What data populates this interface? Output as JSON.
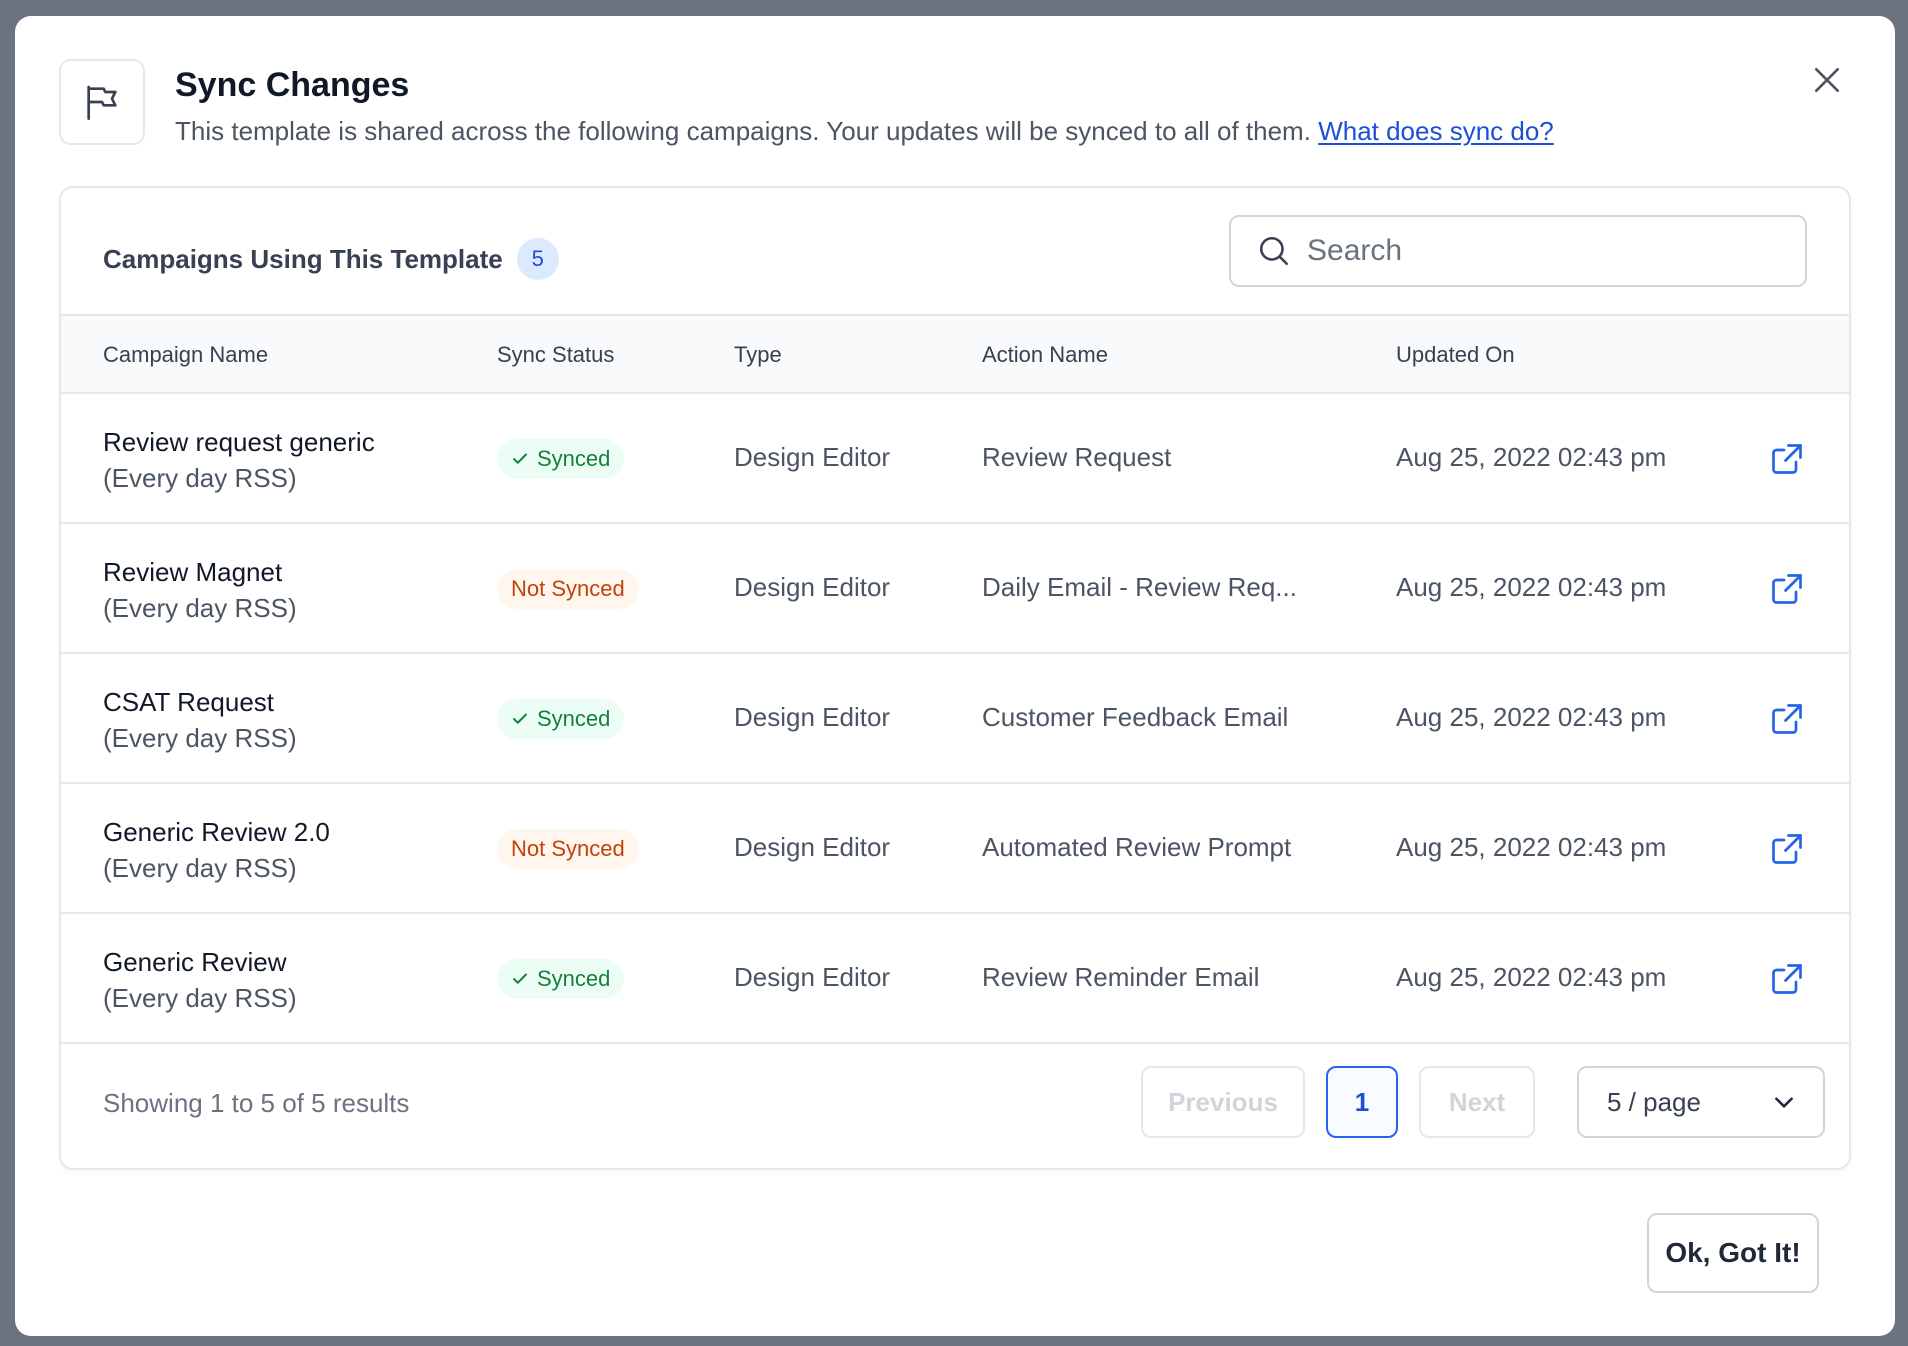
{
  "dialog": {
    "title": "Sync Changes",
    "subtitle": "This template is shared across the following campaigns. Your updates will be synced to all of them.",
    "help_link": "What does sync do?",
    "ok_label": "Ok, Got It!"
  },
  "card": {
    "title": "Campaigns Using This Template",
    "count": "5",
    "search_placeholder": "Search"
  },
  "table": {
    "columns": [
      "Campaign Name",
      "Sync Status",
      "Type",
      "Action Name",
      "Updated On"
    ],
    "rows": [
      {
        "name": "Review request generic",
        "sub": "(Every day RSS)",
        "status": "Synced",
        "type": "Design Editor",
        "action": "Review Request",
        "updated": "Aug 25, 2022 02:43 pm"
      },
      {
        "name": "Review Magnet",
        "sub": "(Every day RSS)",
        "status": "Not Synced",
        "type": "Design Editor",
        "action": "Daily Email - Review Req...",
        "updated": "Aug 25, 2022 02:43 pm"
      },
      {
        "name": "CSAT Request",
        "sub": "(Every day RSS)",
        "status": "Synced",
        "type": "Design Editor",
        "action": "Customer Feedback Email",
        "updated": "Aug 25, 2022 02:43 pm"
      },
      {
        "name": "Generic Review 2.0",
        "sub": "(Every day RSS)",
        "status": "Not Synced",
        "type": "Design Editor",
        "action": "Automated Review Prompt",
        "updated": "Aug 25, 2022 02:43 pm"
      },
      {
        "name": "Generic Review",
        "sub": "(Every day RSS)",
        "status": "Synced",
        "type": "Design Editor",
        "action": "Review Reminder Email",
        "updated": "Aug 25, 2022 02:43 pm"
      }
    ]
  },
  "pagination": {
    "summary": "Showing 1 to 5 of 5 results",
    "previous": "Previous",
    "current_page": "1",
    "next": "Next",
    "page_size": "5 / page"
  },
  "colors": {
    "accent": "#1d4ed8",
    "synced_text": "#15803d",
    "synced_bg": "#ecfdf5",
    "not_synced_text": "#c2410c",
    "not_synced_bg": "#fff7ed"
  },
  "icons": {
    "header": "flag-icon",
    "close": "close-icon",
    "search": "search-icon",
    "status_synced": "check-icon",
    "row_action": "external-link-icon",
    "select": "chevron-down-icon"
  }
}
